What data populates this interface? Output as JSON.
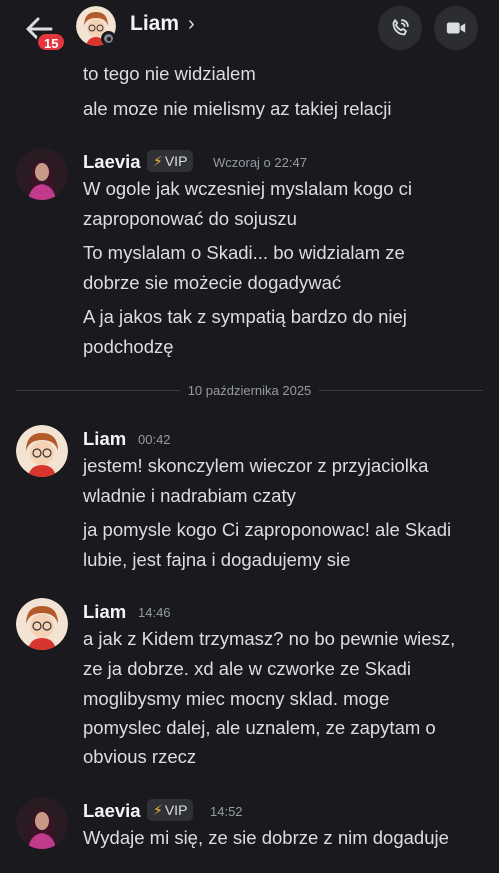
{
  "header": {
    "unread_count": "15",
    "contact_name": "Liam",
    "chevron": "›",
    "icons": {
      "back": "arrow-left-icon",
      "call": "phone-call-icon",
      "video": "video-camera-icon"
    }
  },
  "messages": [
    {
      "lines": [
        "to tego nie widzialem",
        "ale moze nie mielismy az takiej relacji"
      ]
    },
    {
      "author": "Laevia",
      "badge": "VIP",
      "badge_icon": "⚡",
      "time": "Wczoraj o 22:47",
      "lines": [
        "W ogole jak wczesniej myslalam kogo ci",
        "zaproponować do sojuszu",
        "To myslalam o Skadi... bo widzialam ze",
        "dobrze sie możecie dogadywać",
        "A ja jakos tak z sympatią bardzo do niej",
        "podchodzę"
      ]
    },
    {
      "divider": "10 października 2025"
    },
    {
      "author": "Liam",
      "time": "00:42",
      "lines": [
        "jestem! skonczylem wieczor z przyjaciolka",
        "wladnie i nadrabiam czaty",
        "ja pomysle kogo Ci zaproponowac! ale Skadi",
        "lubie, jest fajna i dogadujemy sie"
      ]
    },
    {
      "author": "Liam",
      "time": "14:46",
      "lines": [
        "a jak z Kidem trzymasz? no bo pewnie wiesz,",
        "ze ja dobrze. xd ale w czworke ze Skadi",
        "moglibysmy miec mocny sklad. moge",
        "pomyslec dalej, ale uznalem, ze zapytam o",
        "obvious rzecz"
      ]
    },
    {
      "author": "Laevia",
      "badge": "VIP",
      "badge_icon": "⚡",
      "time": "14:52",
      "lines": [
        "Wydaje mi się, ze sie dobrze z nim dogaduje"
      ]
    }
  ],
  "colors": {
    "background": "#1a1a1e",
    "badge_red": "#e5363e",
    "text": "#dbdee1",
    "muted": "#949ba4",
    "vip_bolt": "#f0b232"
  }
}
